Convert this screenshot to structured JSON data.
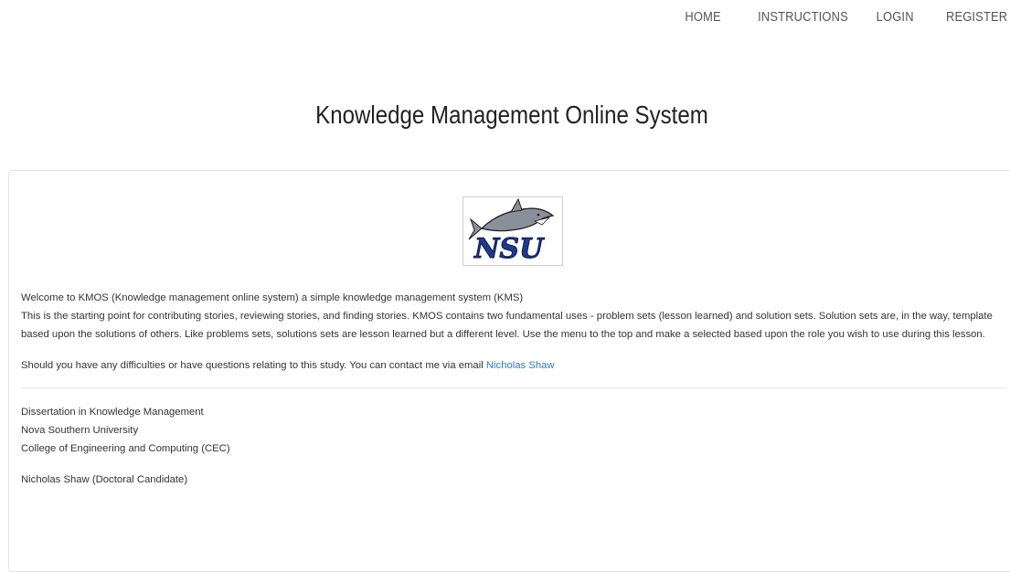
{
  "nav": {
    "items": [
      "HOME",
      "INSTRUCTIONS",
      "LOGIN",
      "REGISTER"
    ]
  },
  "page": {
    "title": "Knowledge Management Online System"
  },
  "logo": {
    "text": "NSU",
    "colors": {
      "navy": "#1f3a8a",
      "gray": "#8a9099",
      "dark": "#1a1a1a"
    }
  },
  "content": {
    "welcome": "Welcome to KMOS (Knowledge management online system) a simple knowledge management system (KMS)",
    "description": "This is the starting point for contributing stories, reviewing stories, and finding stories. KMOS contains two fundamental uses - problem sets (lesson learned) and solution sets. Solution sets are, in the way, template based upon the solutions of others. Like problems sets, solutions sets are lesson learned but a different level. Use the menu to the top and make a selected based upon the role you wish to use during this lesson.",
    "contact_text": "Should you have any difficulties or have questions relating to this study. You can contact me via email ",
    "contact_link": "Nicholas Shaw",
    "dissertation": "Dissertation in Knowledge Management",
    "university": "Nova Southern University",
    "college": "College of Engineering and Computing (CEC)",
    "author": "Nicholas Shaw (Doctoral Candidate)"
  },
  "colors": {
    "link": "#337ab7",
    "text": "#333333"
  }
}
